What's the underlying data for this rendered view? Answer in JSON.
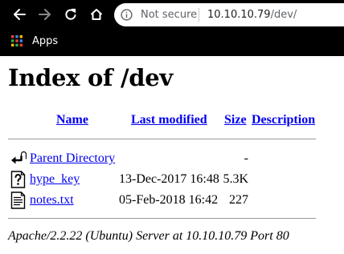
{
  "browser": {
    "security_label": "Not secure",
    "url_host": "10.10.10.79",
    "url_path": "/dev/",
    "bookmarks": [
      {
        "label": "Apps",
        "icon": "apps-grid-icon"
      }
    ],
    "colors": {
      "chrome": "#000000",
      "omnibox": "#ffffff"
    }
  },
  "page": {
    "title": "Index of /dev",
    "columns": {
      "name": "Name",
      "last_modified": "Last modified",
      "size": "Size",
      "description": "Description"
    },
    "entries": [
      {
        "icon": "back-folder-icon",
        "name": "Parent Directory",
        "modified": "",
        "size": "-"
      },
      {
        "icon": "unknown-file-icon",
        "name": "hype_key",
        "modified": "13-Dec-2017 16:48",
        "size": "5.3K"
      },
      {
        "icon": "text-file-icon",
        "name": "notes.txt",
        "modified": "05-Feb-2018 16:42",
        "size": "227"
      }
    ],
    "footer": "Apache/2.2.22 (Ubuntu) Server at 10.10.10.79 Port 80",
    "colors": {
      "link": "#0000ee",
      "rule": "#9a9a9a"
    }
  }
}
